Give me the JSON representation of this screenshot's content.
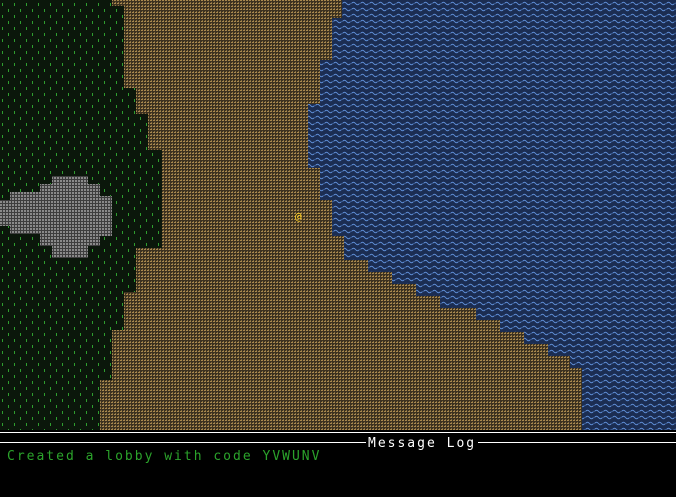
{
  "game": {
    "player_glyph": "@",
    "terrain": [
      {
        "name": "grass",
        "glyph": "\"",
        "color": "#2f9e2f",
        "background": "#0e1a0e"
      },
      {
        "name": "sand",
        "glyph": "·",
        "color": "#b89860",
        "background": "#3a3020"
      },
      {
        "name": "water",
        "glyph": "~",
        "color": "#5a8ad8",
        "background": "#1a2a4a"
      },
      {
        "name": "stone",
        "glyph": "·",
        "color": "#9a9a9a",
        "background": "#404040"
      }
    ],
    "player_color": "#ffd020"
  },
  "message_log": {
    "title": "Message Log",
    "messages": [
      "Created a lobby with code YVWUNV"
    ]
  }
}
